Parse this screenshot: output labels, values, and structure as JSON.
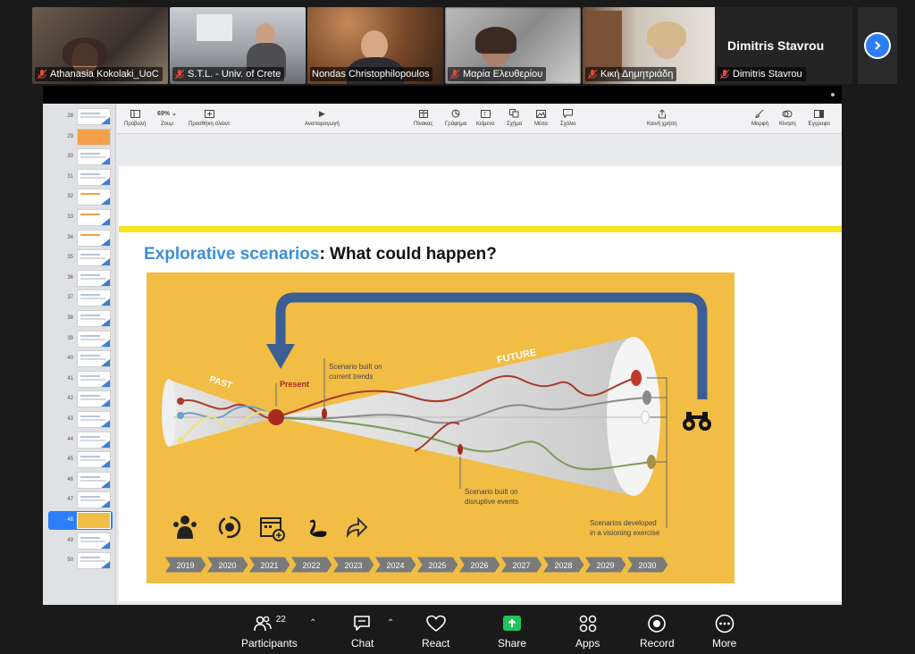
{
  "participants_strip": [
    {
      "name": "Athanasia Kokolaki_UoC"
    },
    {
      "name": "S.T.L. - Univ. of Crete"
    },
    {
      "name": "Nondas Christophilopoulos",
      "active": true
    },
    {
      "name": "Μαρία Ελευθερίου"
    },
    {
      "name": "Κική Δημητριάδη"
    }
  ],
  "name_only_tile": {
    "big_name": "Dimitris Stavrou",
    "tag": "Dimitris Stavrou"
  },
  "toolbar": {
    "view": "Προβολή",
    "zoom_value": "69%",
    "zoom": "Ζουμ",
    "add_slide": "Προσθήκη σλάιντ",
    "play": "Αναπαραγωγή",
    "table": "Πίνακας",
    "chart": "Γράφημα",
    "text": "Κείμενο",
    "shape": "Σχήμα",
    "media": "Μέσα",
    "comment": "Σχόλιο",
    "share": "Κοινή χρήση",
    "format": "Μορφή",
    "animate": "Κίνηση",
    "document": "Έγγραφο"
  },
  "thumbnails": [
    "28",
    "29",
    "30",
    "31",
    "32",
    "33",
    "34",
    "35",
    "36",
    "37",
    "38",
    "39",
    "40",
    "41",
    "42",
    "43",
    "44",
    "45",
    "46",
    "47",
    "48",
    "49",
    "50"
  ],
  "selected_thumbnail": "48",
  "slide": {
    "title_blue": "Explorative scenarios",
    "title_black": ": What could happen?",
    "labels": {
      "past": "PAST",
      "present": "Present",
      "future": "FUTURE",
      "trend_line1": "Scenario built on",
      "trend_line2": "current trends",
      "disrupt_line1": "Scenario built on",
      "disrupt_line2": "disruptive events",
      "vision_line1": "Scenarios developed",
      "vision_line2": "in a visioning exercise"
    },
    "years": [
      "2019",
      "2020",
      "2021",
      "2022",
      "2023",
      "2024",
      "2025",
      "2026",
      "2027",
      "2028",
      "2029",
      "2030"
    ]
  },
  "controls": {
    "participants_count": "22",
    "participants": "Participants",
    "chat": "Chat",
    "react": "React",
    "share": "Share",
    "apps": "Apps",
    "record": "Record",
    "more": "More"
  },
  "colors": {
    "accent_green": "#2fd26b",
    "accent_blue": "#2d7ff9",
    "slide_yellow": "#f1bd45",
    "title_blue": "#3b8fd9",
    "share_green": "#1fc45a"
  }
}
